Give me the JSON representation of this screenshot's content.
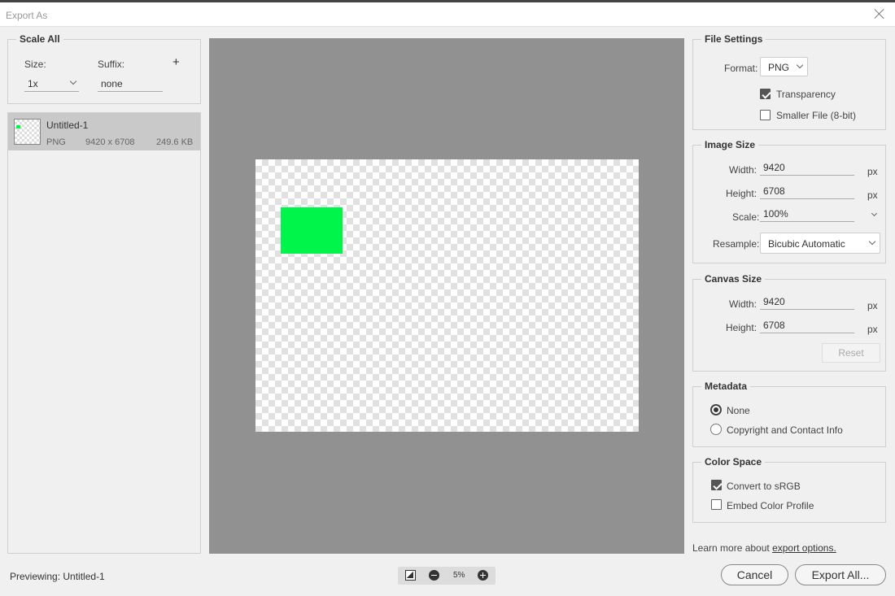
{
  "window": {
    "title": "Export As"
  },
  "scale_all": {
    "legend": "Scale All",
    "size_label": "Size:",
    "size_value": "1x",
    "suffix_label": "Suffix:",
    "suffix_placeholder": "none",
    "add_symbol": "+"
  },
  "asset": {
    "name": "Untitled-1",
    "format": "PNG",
    "dimensions": "9420 x 6708",
    "filesize": "249.6 KB"
  },
  "file_settings": {
    "legend": "File Settings",
    "format_label": "Format:",
    "format_value": "PNG",
    "transparency_label": "Transparency",
    "transparency_checked": true,
    "smaller_file_label": "Smaller File (8-bit)",
    "smaller_file_checked": false
  },
  "image_size": {
    "legend": "Image Size",
    "width_label": "Width:",
    "width_value": "9420",
    "height_label": "Height:",
    "height_value": "6708",
    "unit": "px",
    "scale_label": "Scale:",
    "scale_value": "100%",
    "resample_label": "Resample:",
    "resample_value": "Bicubic Automatic"
  },
  "canvas_size": {
    "legend": "Canvas Size",
    "width_label": "Width:",
    "width_value": "9420",
    "height_label": "Height:",
    "height_value": "6708",
    "unit": "px",
    "reset_label": "Reset"
  },
  "metadata": {
    "legend": "Metadata",
    "options": [
      "None",
      "Copyright and Contact Info"
    ],
    "selected": "None"
  },
  "color_space": {
    "legend": "Color Space",
    "convert_label": "Convert to sRGB",
    "convert_checked": true,
    "embed_label": "Embed Color Profile",
    "embed_checked": false
  },
  "footer": {
    "previewing_label": "Previewing:",
    "previewing_value": "Untitled-1",
    "zoom_value": "5%",
    "learn_more_prefix": "Learn more about",
    "learn_more_link": "export options.",
    "cancel_label": "Cancel",
    "export_label": "Export All..."
  },
  "colors": {
    "preview_bg": "#919191",
    "green_shape": "#00f54a"
  }
}
